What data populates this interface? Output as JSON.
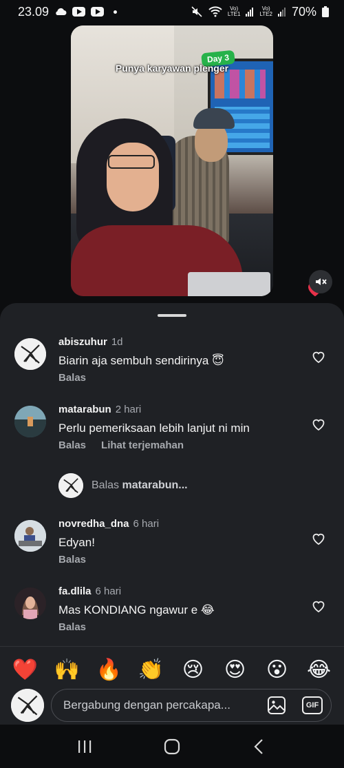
{
  "status_bar": {
    "time": "23.09",
    "battery": "70%",
    "lte1": "Vo)\nLTE1",
    "lte2": "Vo)\nLTE2"
  },
  "video": {
    "badge": "Day 3",
    "caption": "Punya karyawan plenger"
  },
  "comments": [
    {
      "user": "abiszuhur",
      "time": "1d",
      "text": "Biarin aja sembuh sendirinya 😇",
      "actions": [
        "Balas"
      ]
    },
    {
      "user": "matarabun",
      "time": "2 hari",
      "text": "Perlu pemeriksaan lebih lanjut ni min",
      "actions": [
        "Balas",
        "Lihat terjemahan"
      ]
    },
    {
      "user": "novredha_dna",
      "time": "6 hari",
      "text": "Edyan!",
      "actions": [
        "Balas"
      ]
    },
    {
      "user": "fa.dlila",
      "time": "6 hari",
      "text": "Mas KONDIANG ngawur e 😂",
      "actions": [
        "Balas"
      ]
    }
  ],
  "reply_thread": {
    "prefix": "Balas",
    "user": "matarabun..."
  },
  "emojis": [
    "❤️",
    "🙌",
    "🔥",
    "👏",
    "😢",
    "😍",
    "😮",
    "😂"
  ],
  "input": {
    "placeholder": "Bergabung dengan percakapa...",
    "gif_label": "GIF"
  },
  "icons": {
    "heart_outline": "heart-outline-icon",
    "mute": "mute-icon",
    "photo": "photo-icon"
  },
  "colors": {
    "sheet_bg": "#1f2125",
    "page_bg": "#0c0d0f",
    "accent_green": "#27b24a",
    "heart_red": "#e8314a"
  }
}
